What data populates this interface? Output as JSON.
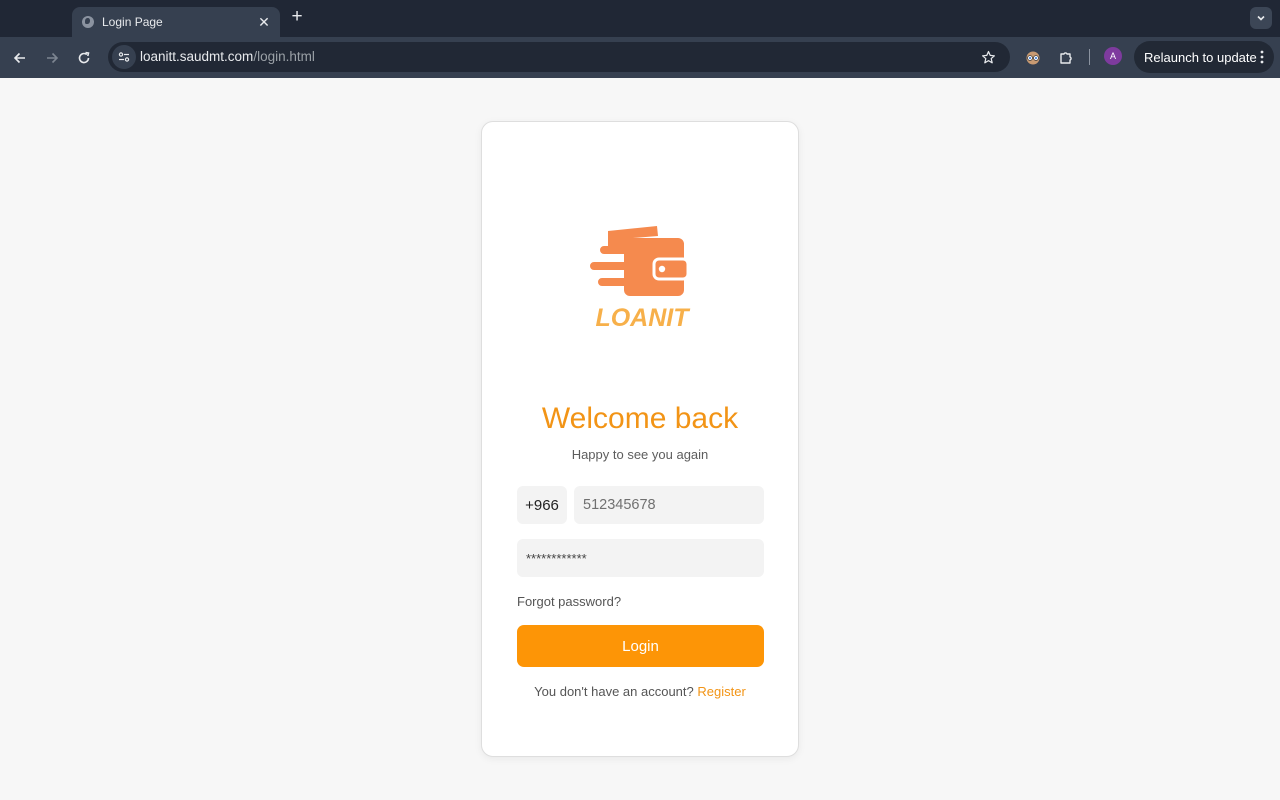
{
  "browser": {
    "tab_title": "Login Page",
    "url_host": "loanitt.saudmt.com",
    "url_path": "/login.html",
    "profile_initial": "A",
    "relaunch_label": "Relaunch to update"
  },
  "login": {
    "logo_text": "LOANIT",
    "heading": "Welcome back",
    "subtitle": "Happy to see you again",
    "country_code": "+966",
    "phone_placeholder": "512345678",
    "password_placeholder": "************",
    "forgot_label": "Forgot password?",
    "login_label": "Login",
    "no_account_text": "You don't have an account?",
    "register_label": "Register"
  },
  "colors": {
    "brand_orange": "#f29416",
    "button_orange": "#fd9506",
    "logo_orange": "#f58a4e",
    "logo_text": "#f7b04a"
  }
}
